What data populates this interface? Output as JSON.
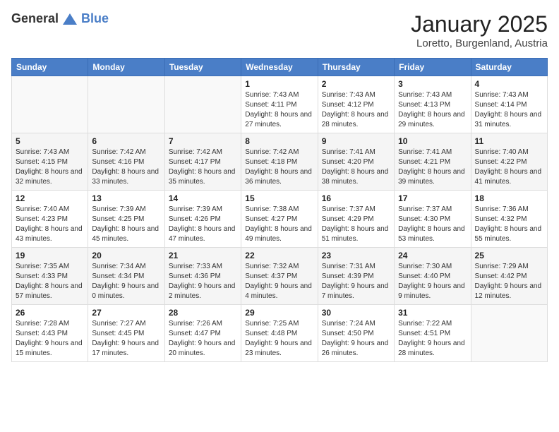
{
  "header": {
    "logo_general": "General",
    "logo_blue": "Blue",
    "month": "January 2025",
    "location": "Loretto, Burgenland, Austria"
  },
  "days_of_week": [
    "Sunday",
    "Monday",
    "Tuesday",
    "Wednesday",
    "Thursday",
    "Friday",
    "Saturday"
  ],
  "weeks": [
    [
      {
        "day": "",
        "info": ""
      },
      {
        "day": "",
        "info": ""
      },
      {
        "day": "",
        "info": ""
      },
      {
        "day": "1",
        "info": "Sunrise: 7:43 AM\nSunset: 4:11 PM\nDaylight: 8 hours and 27 minutes."
      },
      {
        "day": "2",
        "info": "Sunrise: 7:43 AM\nSunset: 4:12 PM\nDaylight: 8 hours and 28 minutes."
      },
      {
        "day": "3",
        "info": "Sunrise: 7:43 AM\nSunset: 4:13 PM\nDaylight: 8 hours and 29 minutes."
      },
      {
        "day": "4",
        "info": "Sunrise: 7:43 AM\nSunset: 4:14 PM\nDaylight: 8 hours and 31 minutes."
      }
    ],
    [
      {
        "day": "5",
        "info": "Sunrise: 7:43 AM\nSunset: 4:15 PM\nDaylight: 8 hours and 32 minutes."
      },
      {
        "day": "6",
        "info": "Sunrise: 7:42 AM\nSunset: 4:16 PM\nDaylight: 8 hours and 33 minutes."
      },
      {
        "day": "7",
        "info": "Sunrise: 7:42 AM\nSunset: 4:17 PM\nDaylight: 8 hours and 35 minutes."
      },
      {
        "day": "8",
        "info": "Sunrise: 7:42 AM\nSunset: 4:18 PM\nDaylight: 8 hours and 36 minutes."
      },
      {
        "day": "9",
        "info": "Sunrise: 7:41 AM\nSunset: 4:20 PM\nDaylight: 8 hours and 38 minutes."
      },
      {
        "day": "10",
        "info": "Sunrise: 7:41 AM\nSunset: 4:21 PM\nDaylight: 8 hours and 39 minutes."
      },
      {
        "day": "11",
        "info": "Sunrise: 7:40 AM\nSunset: 4:22 PM\nDaylight: 8 hours and 41 minutes."
      }
    ],
    [
      {
        "day": "12",
        "info": "Sunrise: 7:40 AM\nSunset: 4:23 PM\nDaylight: 8 hours and 43 minutes."
      },
      {
        "day": "13",
        "info": "Sunrise: 7:39 AM\nSunset: 4:25 PM\nDaylight: 8 hours and 45 minutes."
      },
      {
        "day": "14",
        "info": "Sunrise: 7:39 AM\nSunset: 4:26 PM\nDaylight: 8 hours and 47 minutes."
      },
      {
        "day": "15",
        "info": "Sunrise: 7:38 AM\nSunset: 4:27 PM\nDaylight: 8 hours and 49 minutes."
      },
      {
        "day": "16",
        "info": "Sunrise: 7:37 AM\nSunset: 4:29 PM\nDaylight: 8 hours and 51 minutes."
      },
      {
        "day": "17",
        "info": "Sunrise: 7:37 AM\nSunset: 4:30 PM\nDaylight: 8 hours and 53 minutes."
      },
      {
        "day": "18",
        "info": "Sunrise: 7:36 AM\nSunset: 4:32 PM\nDaylight: 8 hours and 55 minutes."
      }
    ],
    [
      {
        "day": "19",
        "info": "Sunrise: 7:35 AM\nSunset: 4:33 PM\nDaylight: 8 hours and 57 minutes."
      },
      {
        "day": "20",
        "info": "Sunrise: 7:34 AM\nSunset: 4:34 PM\nDaylight: 9 hours and 0 minutes."
      },
      {
        "day": "21",
        "info": "Sunrise: 7:33 AM\nSunset: 4:36 PM\nDaylight: 9 hours and 2 minutes."
      },
      {
        "day": "22",
        "info": "Sunrise: 7:32 AM\nSunset: 4:37 PM\nDaylight: 9 hours and 4 minutes."
      },
      {
        "day": "23",
        "info": "Sunrise: 7:31 AM\nSunset: 4:39 PM\nDaylight: 9 hours and 7 minutes."
      },
      {
        "day": "24",
        "info": "Sunrise: 7:30 AM\nSunset: 4:40 PM\nDaylight: 9 hours and 9 minutes."
      },
      {
        "day": "25",
        "info": "Sunrise: 7:29 AM\nSunset: 4:42 PM\nDaylight: 9 hours and 12 minutes."
      }
    ],
    [
      {
        "day": "26",
        "info": "Sunrise: 7:28 AM\nSunset: 4:43 PM\nDaylight: 9 hours and 15 minutes."
      },
      {
        "day": "27",
        "info": "Sunrise: 7:27 AM\nSunset: 4:45 PM\nDaylight: 9 hours and 17 minutes."
      },
      {
        "day": "28",
        "info": "Sunrise: 7:26 AM\nSunset: 4:47 PM\nDaylight: 9 hours and 20 minutes."
      },
      {
        "day": "29",
        "info": "Sunrise: 7:25 AM\nSunset: 4:48 PM\nDaylight: 9 hours and 23 minutes."
      },
      {
        "day": "30",
        "info": "Sunrise: 7:24 AM\nSunset: 4:50 PM\nDaylight: 9 hours and 26 minutes."
      },
      {
        "day": "31",
        "info": "Sunrise: 7:22 AM\nSunset: 4:51 PM\nDaylight: 9 hours and 28 minutes."
      },
      {
        "day": "",
        "info": ""
      }
    ]
  ]
}
